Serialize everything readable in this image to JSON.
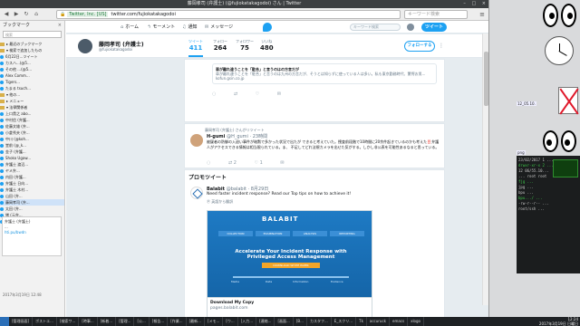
{
  "window": {
    "title": "藤岡孝司 (弁護士) (@fujiokatakagodoi) さん | Twitter",
    "controls": [
      "–",
      "□",
      "×"
    ]
  },
  "navbar": {
    "back": "◀",
    "forward": "▶",
    "reload": "↻",
    "home": "⌂",
    "url_tag": "Twitter, Inc. [US]",
    "url": "twitter.com/fujiokatakagodoi",
    "search_placeholder": "キーワード検索",
    "menu": "≡"
  },
  "sidebar": {
    "title": "ブックマーク",
    "close": "×",
    "search_placeholder": "検索",
    "items": [
      {
        "label": "▸ 最近のブックマーク",
        "icon": "folder-icon"
      },
      {
        "label": "▾ 検索で追加したもの",
        "icon": "folder-icon"
      },
      {
        "label": "6月22日...ツイート",
        "icon": "twitter-icon"
      },
      {
        "label": "カスハ...(@5...",
        "icon": "twitter-icon"
      },
      {
        "label": "その他 ...(@5...",
        "icon": "twitter-icon"
      },
      {
        "label": "Alex Comm...",
        "icon": "twitter-icon"
      },
      {
        "label": "Tigers...",
        "icon": "twitter-icon"
      },
      {
        "label": "たまる tsuch...",
        "icon": "twitter-icon"
      },
      {
        "label": "▾ 他の...",
        "icon": "folder-icon"
      },
      {
        "label": "▸ メニュー",
        "icon": "folder-icon"
      },
      {
        "label": "▾ 法律関係者",
        "icon": "folder-icon"
      },
      {
        "label": "上口貴之 abo...",
        "icon": "twitter-icon"
      },
      {
        "label": "中村信 (弁護...",
        "icon": "twitter-icon"
      },
      {
        "label": "佐藤文雄 (弁...",
        "icon": "twitter-icon"
      },
      {
        "label": "小倉秀夫 (弁...",
        "icon": "twitter-icon"
      },
      {
        "label": "中川 (@koh...",
        "icon": "twitter-icon"
      },
      {
        "label": "堂前 (@_k...",
        "icon": "twitter-icon"
      },
      {
        "label": "金子 (弁護...",
        "icon": "twitter-icon"
      },
      {
        "label": "Shoko Ugaw...",
        "icon": "twitter-icon"
      },
      {
        "label": "弁護士 渡辺...",
        "icon": "twitter-icon"
      },
      {
        "label": "ヤメ弁...",
        "icon": "twitter-icon"
      },
      {
        "label": "内田 (弁護...",
        "icon": "twitter-icon"
      },
      {
        "label": "弁護士 日向...",
        "icon": "twitter-icon"
      },
      {
        "label": "弁護士 木村...",
        "icon": "twitter-icon"
      },
      {
        "label": "山田 (弁...",
        "icon": "twitter-icon"
      },
      {
        "label": "藤岡孝司 (弁...",
        "icon": "twitter-icon"
      },
      {
        "label": "太田 (弁...",
        "icon": "twitter-icon"
      },
      {
        "label": "猪 (元弁...",
        "icon": "twitter-icon"
      },
      {
        "label": "福岡 (弁...",
        "icon": "twitter-icon"
      }
    ],
    "selected_index": 25,
    "preview": {
      "line1": "弁護士 (弁護士)",
      "line2": "...",
      "link": "hti.pu/bwdn",
      "timestamp": "2017年3月19日 12:48"
    },
    "footer": "ニコニコ..."
  },
  "twitter_header": {
    "home": "ホーム",
    "moments": "モーメント",
    "notifications": "通知",
    "messages": "メッセージ",
    "search_placeholder": "キーワード検索",
    "tweet_button": "ツイート"
  },
  "profile": {
    "name": "藤岡孝司 (弁護士)",
    "handle": "@fujiokatakagodoi",
    "stats": [
      {
        "label": "ツイート",
        "value": "411",
        "active": true
      },
      {
        "label": "フォロー",
        "value": "264",
        "active": false
      },
      {
        "label": "フォロワー",
        "value": "75",
        "active": false
      },
      {
        "label": "いいね",
        "value": "480",
        "active": false
      }
    ],
    "follow_button": "フォローする",
    "more": "⋮"
  },
  "tweet1": {
    "card_title": "車が離れ違うことを「駐合」と言うのはの方言だが",
    "card_desc": "車が離れ違うことを「駐合」と言うのは九州の方言だが、そうとは知らずに使っている人は多い。私も東京勤務時代、驚愕お男...",
    "card_url": "kofun.gsin.co.jp",
    "actions": [
      "◌",
      "⇄",
      "♡",
      "✉"
    ]
  },
  "tweet2": {
    "retweeted_by": "藤岡孝司 (弁護士) さんがリツイート",
    "author": "H-gumi",
    "handle": "@H_gumi · 23時間",
    "body": "被疑者の防御の入退い事件が暗黙で多かった状況で出たが できると考えていた。捜査前段階で10時間に20余件起きているのかも考えた‼️弁護人がアクセスできる情報は相当限られている。ま、 不足してどれ法規カメラを出せた気がする。しかし非公表を可能性あるなると思っている。",
    "actions": [
      "◌",
      "⇄ 2",
      "♡ 1",
      "✉"
    ]
  },
  "promo": {
    "section_title": "プロモツイート",
    "author": "Balabit",
    "handle": "@balabit · 8月29日",
    "body": "Need faster incident response? Read our Top tips on how to achieve it!",
    "promoted_label": "Ⓟ 英語から翻訳",
    "img_brand": "BALABIT",
    "img_steps": [
      "COLLECTION",
      "EXAMINATION",
      "ANALYSIS",
      "REPORTING"
    ],
    "img_headline": "Accelerate Your Incident Response with Privileged Access Management",
    "img_cta": "DOWNLOAD WHITE PAPER",
    "img_flow_labels": [
      "Media",
      "Data",
      "Information",
      "Evidence"
    ],
    "card_title": "Download My Copy",
    "card_url": "pages.balabit.com"
  },
  "desktop": {
    "term_lines": [
      "23/02/2017 1 ...",
      "drwxr-xr-x 2 ...",
      "12 06/55.10...",
      "... root root",
      "fjg ...",
      "jpg ...",
      "bpu ...",
      "bpu.../ ...",
      "-rw-r--r-- ...",
      "root/ssh ..."
    ],
    "file_label_1": "12_05.10.",
    "file_label_2": "png"
  },
  "taskbar": {
    "tasks": [
      "[管理画面]",
      "ポストエ...",
      "[検索ワ...",
      "[時事...",
      "[新着...",
      "[管理...",
      "[公...",
      "[報告...",
      "[作業...",
      "[最新...",
      "[メモ...",
      "[ウ...",
      "[入力...",
      "[連絡...",
      "[画面...",
      "[B...",
      "カスタフ...",
      "E_スクリ...",
      "Tk",
      "accuruck",
      "emacs",
      "xlogo"
    ],
    "time": "12:24",
    "date": "2017年3月19日 日曜日"
  }
}
